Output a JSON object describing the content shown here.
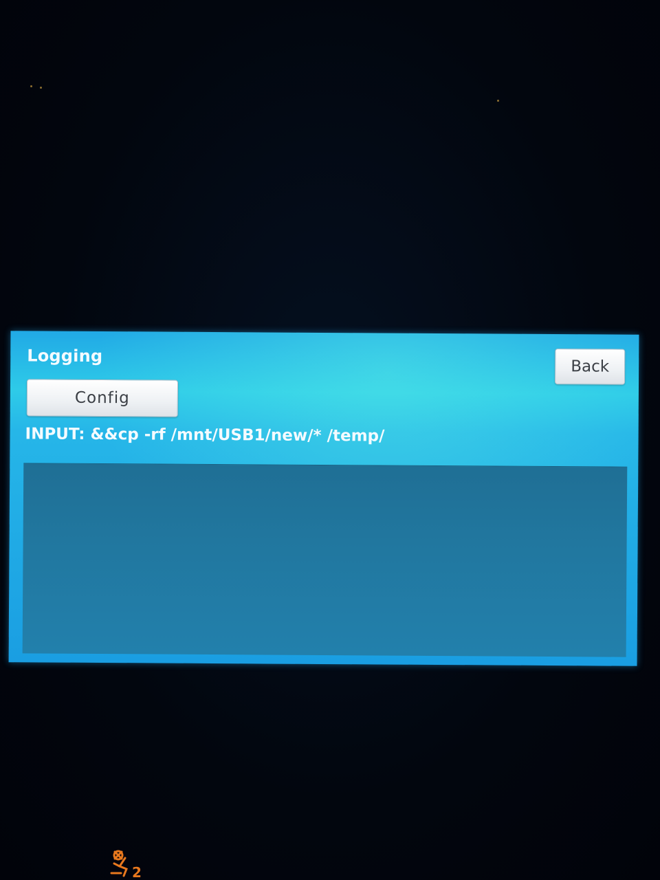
{
  "screen": {
    "title": "Logging",
    "config_button_label": "Config",
    "back_button_label": "Back",
    "input_label": "INPUT: &&cp -rf /mnt/USB1/new/* /temp/",
    "log_text": ""
  },
  "dashboard": {
    "airbag_indicator_icon": "passenger-airbag-off-icon",
    "airbag_indicator_color": "#e8781e"
  },
  "colors": {
    "screen_bg": "#21a9e6",
    "log_area_bg": "#21779f",
    "button_bg": "#ffffff",
    "text": "#f4fbff"
  }
}
